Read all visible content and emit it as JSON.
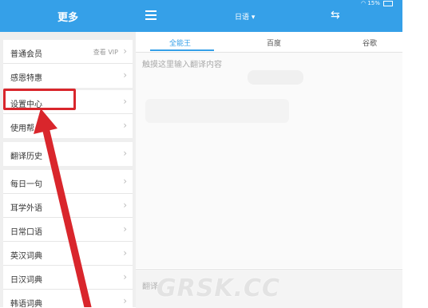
{
  "sidebar": {
    "title": "更多",
    "group1": [
      {
        "label": "普通会员",
        "right": "查看 VIP"
      },
      {
        "label": "感恩特惠",
        "right": ""
      }
    ],
    "group2": [
      {
        "label": "设置中心"
      },
      {
        "label": "使用帮"
      }
    ],
    "group3": [
      {
        "label": "翻译历史"
      }
    ],
    "group4": [
      {
        "label": "每日一句"
      },
      {
        "label": "耳学外语"
      },
      {
        "label": "日常口语"
      },
      {
        "label": "英汉词典"
      },
      {
        "label": "日汉词典"
      },
      {
        "label": "韩语词典"
      }
    ]
  },
  "topbar": {
    "language": "日语",
    "dropdown_arrow": "▾",
    "swap_icon": "⇆",
    "status_battery": "15%"
  },
  "tabs": [
    "全能王",
    "百度",
    "谷歌"
  ],
  "active_tab": "全能王",
  "input": {
    "placeholder": "触摸这里输入翻译内容"
  },
  "bottom": {
    "hint": "翻译"
  },
  "watermark": "GRSK.CC",
  "colors": {
    "brand_blue": "#35a0e8",
    "annotation_red": "#d9262c"
  },
  "icons": {
    "chevron": "›",
    "menu": "hamburger-icon",
    "swap": "swap-icon"
  }
}
